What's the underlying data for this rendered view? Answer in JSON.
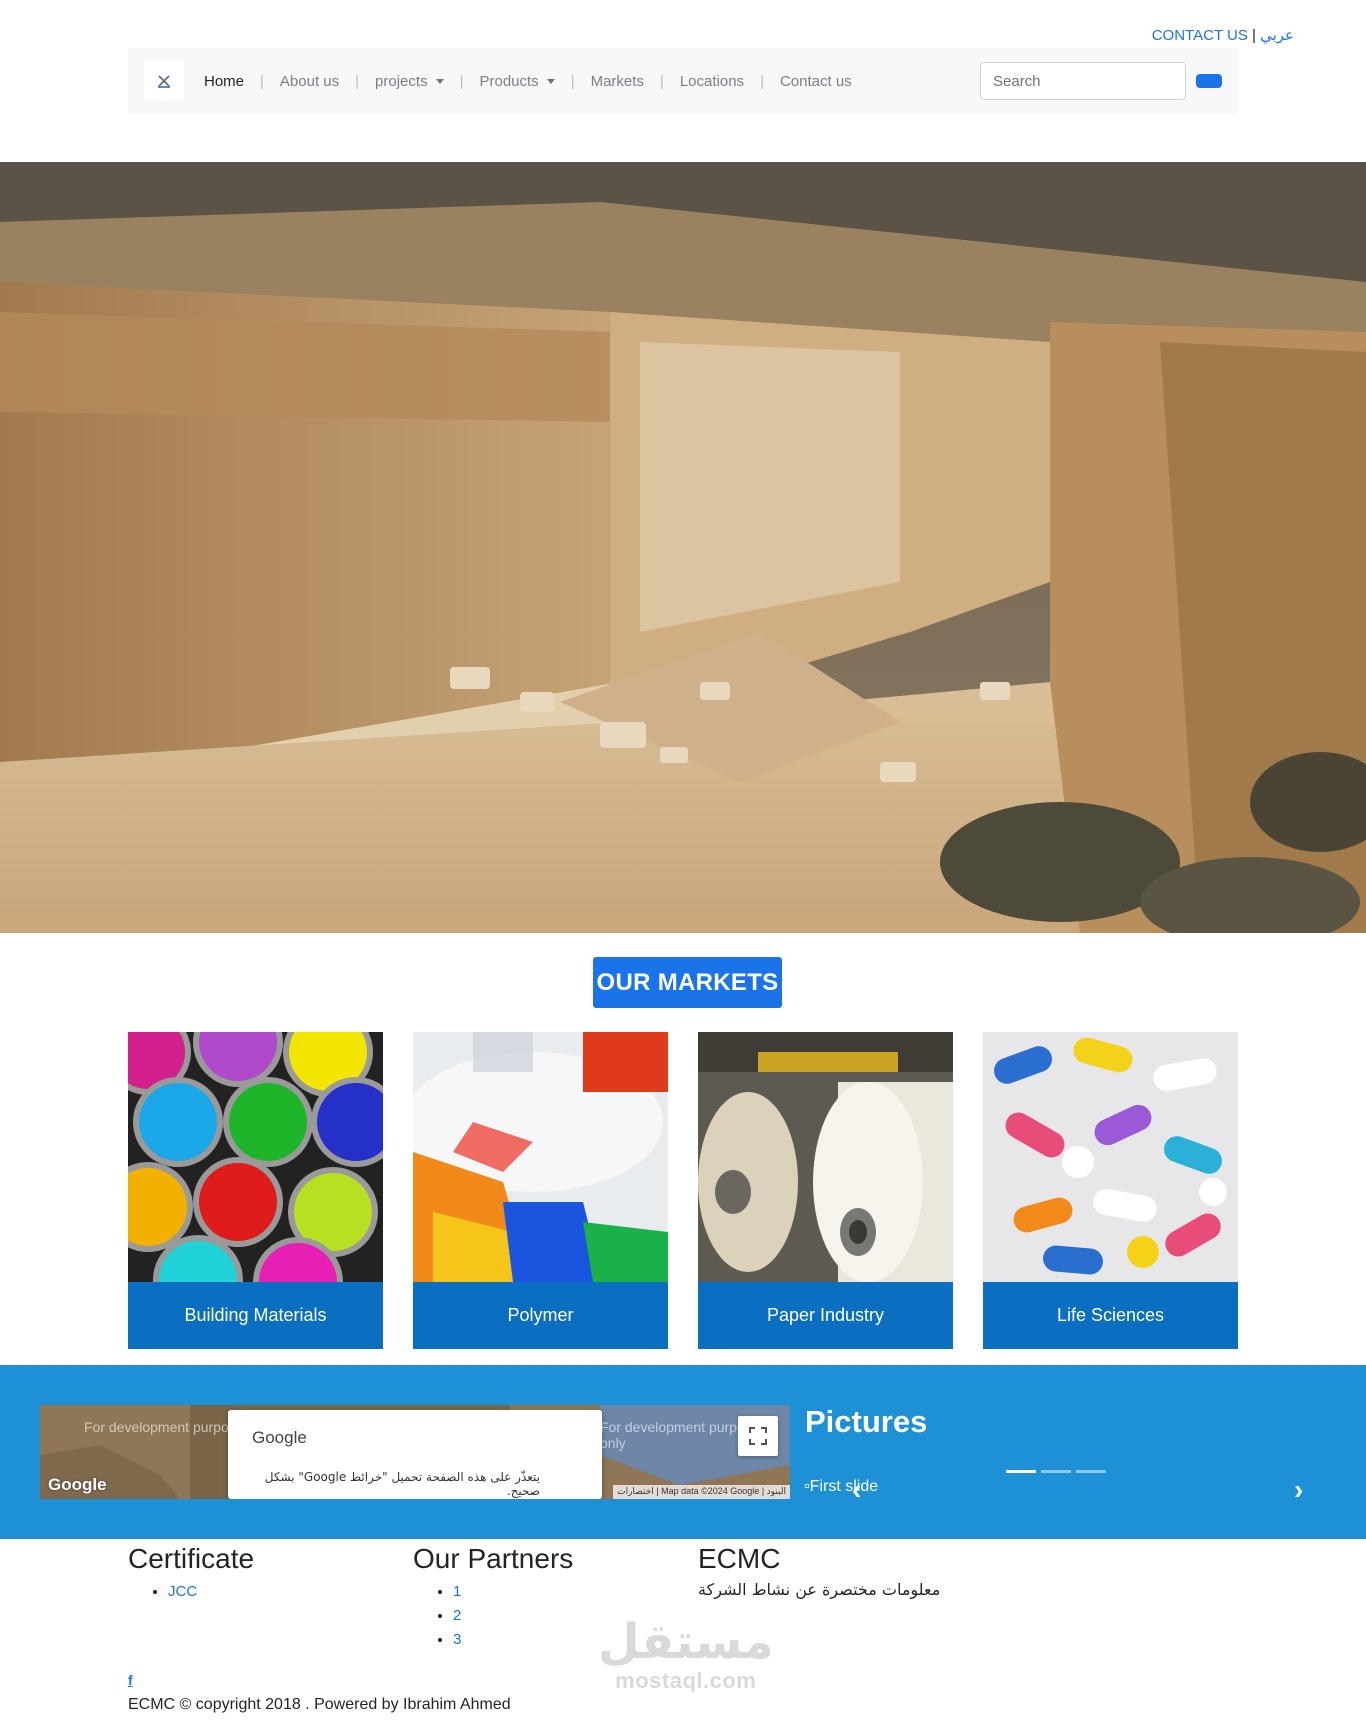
{
  "topbar": {
    "contact_label": "CONTACT US",
    "separator": "|",
    "lang_label": "عربي"
  },
  "navbar": {
    "items": [
      {
        "label": "Home",
        "active": true
      },
      {
        "label": "About us"
      },
      {
        "label": "projects",
        "dropdown": true
      },
      {
        "label": "Products",
        "dropdown": true
      },
      {
        "label": "Markets"
      },
      {
        "label": "Locations"
      },
      {
        "label": "Contact us"
      }
    ],
    "separator": "|",
    "search_placeholder": "Search"
  },
  "markets": {
    "title": "OUR MARKETS",
    "cards": [
      {
        "label": "Building Materials"
      },
      {
        "label": "Polymer"
      },
      {
        "label": "Paper Industry"
      },
      {
        "label": "Life Sciences"
      }
    ]
  },
  "map": {
    "dev_text": "For development purposes only",
    "popup_title": "Google",
    "popup_message": "يتعذّر على هذه الصفحة تحميل \"خرائط Google\" بشكل صحيح.",
    "attribution": "Map data ©2024 Google",
    "attribution_links": [
      "اختصارات",
      "البنود"
    ],
    "logo_text": "Google"
  },
  "pictures": {
    "title": "Pictures",
    "slide_alt": "First slide",
    "indicator_count": 3,
    "active_indicator": 0
  },
  "footer": {
    "certificate": {
      "title": "Certificate",
      "items": [
        "JCC"
      ]
    },
    "partners": {
      "title": "Our Partners",
      "items": [
        "1",
        "2",
        "3"
      ]
    },
    "company": {
      "title": "ECMC",
      "description": "معلومات مختصرة عن نشاط الشركة"
    },
    "facebook_icon_text": "f",
    "copyright": "ECMC © copyright 2018 . Powered by Ibrahim Ahmed"
  },
  "watermark": {
    "arabic": "مستقل",
    "latin": "mostaql.com"
  },
  "colors": {
    "accent": "#1a73e8",
    "band": "#1e90d6",
    "card_label": "#0a6fc0"
  }
}
